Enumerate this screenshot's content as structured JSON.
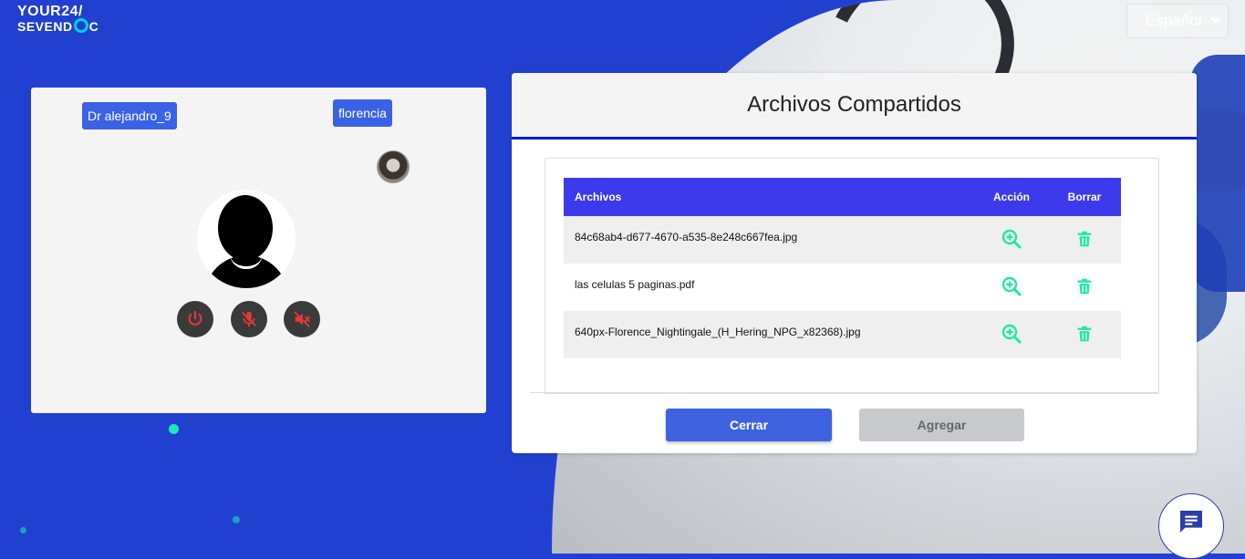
{
  "brand": {
    "line1": "YOUR24/",
    "line2_a": "SEVEND",
    "line2_b": "C"
  },
  "language": {
    "selected": "Español"
  },
  "video": {
    "doctor_name": "Dr alejandro_9",
    "patient_name": "florencia",
    "controls": [
      {
        "icon": "power-icon",
        "color": "#e53935"
      },
      {
        "icon": "mic-off-icon",
        "color": "#e53935"
      },
      {
        "icon": "volume-off-icon",
        "color": "#e53935"
      }
    ]
  },
  "modal": {
    "title": "Archivos Compartidos",
    "columns": {
      "file": "Archivos",
      "action": "Acción",
      "delete": "Borrar"
    },
    "files": [
      {
        "name": "84c68ab4-d677-4670-a535-8e248c667fea.jpg"
      },
      {
        "name": "las celulas 5 paginas.pdf"
      },
      {
        "name": "640px-Florence_Nightingale_(H_Hering_NPG_x82368).jpg"
      }
    ],
    "close_label": "Cerrar",
    "add_label": "Agregar"
  },
  "colors": {
    "accent": "#3b3beb",
    "green": "#1de9a0",
    "background": "#2240d0"
  }
}
